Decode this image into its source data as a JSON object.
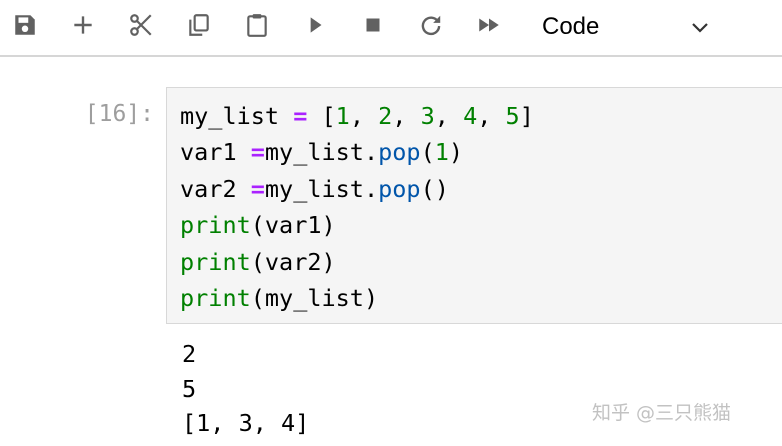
{
  "toolbar": {
    "buttons": [
      {
        "icon": "save-icon"
      },
      {
        "icon": "plus-icon"
      },
      {
        "icon": "scissors-icon"
      },
      {
        "icon": "copy-icon"
      },
      {
        "icon": "clipboard-icon"
      },
      {
        "icon": "play-icon"
      },
      {
        "icon": "stop-icon"
      },
      {
        "icon": "refresh-icon"
      },
      {
        "icon": "fast-forward-icon"
      }
    ],
    "cell_type": "Code"
  },
  "cell": {
    "prompt": "[16]:",
    "code_lines": [
      "my_list = [1, 2, 3, 4, 5]",
      "var1 =my_list.pop(1)",
      "var2 =my_list.pop()",
      "print(var1)",
      "print(var2)",
      "print(my_list)"
    ],
    "output_lines": [
      "2",
      "5",
      "[1, 3, 4]"
    ]
  },
  "watermark": "知乎 @三只熊猫",
  "colors": {
    "prompt": "#9e9e9e",
    "operator": "#aa22ff",
    "number": "#008000",
    "builtin": "#008000",
    "method": "#0055aa",
    "cell_background": "#f5f5f5"
  }
}
